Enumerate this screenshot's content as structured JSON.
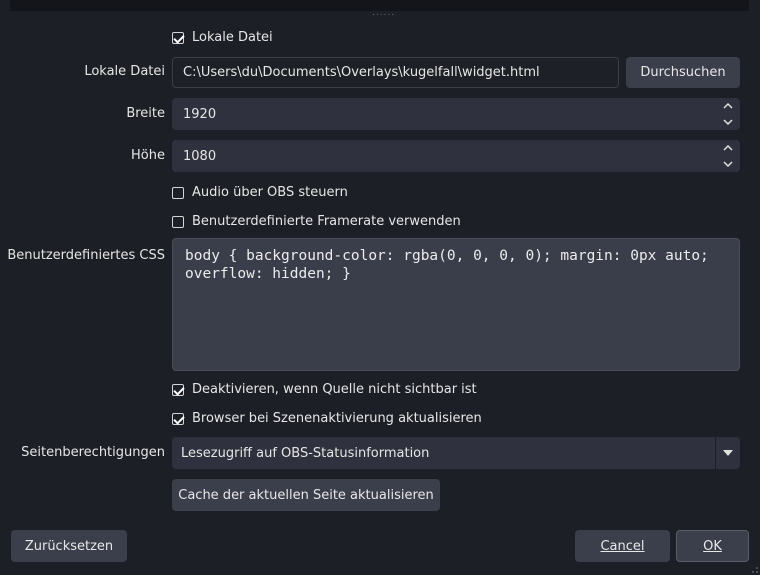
{
  "grip": "......",
  "lokale_datei_checkbox": {
    "label": "Lokale Datei",
    "checked": true
  },
  "lokale_datei": {
    "label": "Lokale Datei",
    "value": "C:\\Users\\du\\Documents\\Overlays\\kugelfall\\widget.html",
    "browse_button": "Durchsuchen"
  },
  "breite": {
    "label": "Breite",
    "value": "1920"
  },
  "hoehe": {
    "label": "Höhe",
    "value": "1080"
  },
  "audio_checkbox": {
    "label": "Audio über OBS steuern",
    "checked": false
  },
  "framerate_checkbox": {
    "label": "Benutzerdefinierte Framerate verwenden",
    "checked": false
  },
  "custom_css": {
    "label": "Benutzerdefiniertes CSS",
    "line1": "body { background-color: rgba(0, 0, 0, 0); margin: 0px auto;",
    "line2": "overflow: hidden; }"
  },
  "deactivate_checkbox": {
    "label": "Deaktivieren, wenn Quelle nicht sichtbar ist",
    "checked": true
  },
  "refresh_checkbox": {
    "label": "Browser bei Szenenaktivierung aktualisieren",
    "checked": true
  },
  "permissions": {
    "label": "Seitenberechtigungen",
    "selected": "Lesezugriff auf OBS-Statusinformation"
  },
  "cache_button": "Cache der aktuellen Seite aktualisieren",
  "footer": {
    "reset": "Zurücksetzen",
    "cancel": "Cancel",
    "ok": "OK"
  },
  "colors": {
    "background": "#1d1f26",
    "field": "#2f323e",
    "button": "#3b3e4b",
    "css_box": "#3a3d4a"
  }
}
